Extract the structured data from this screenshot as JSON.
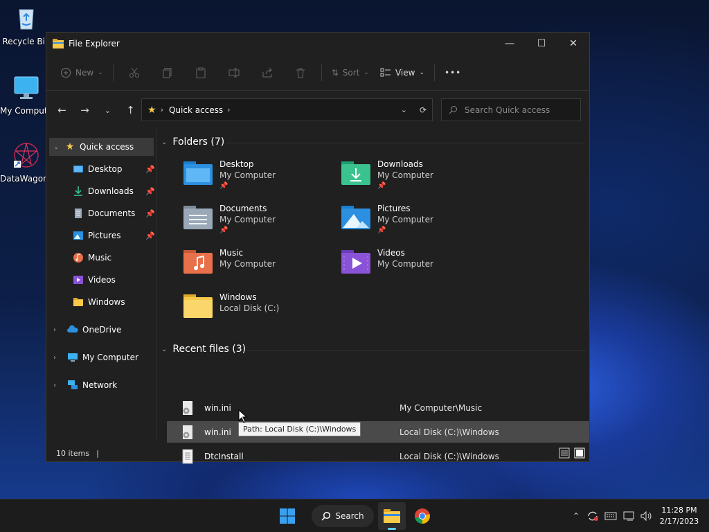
{
  "desktop": {
    "icons": [
      {
        "label": "Recycle Bin"
      },
      {
        "label": "My Computer"
      },
      {
        "label": "DataWagon..."
      }
    ]
  },
  "window": {
    "title": "File Explorer",
    "controls": {
      "minimize": "—",
      "maximize": "☐",
      "close": "✕"
    }
  },
  "toolbar": {
    "new_label": "New",
    "sort_label": "Sort",
    "view_label": "View",
    "more_label": "•••"
  },
  "address": {
    "location": "Quick access"
  },
  "search": {
    "placeholder": "Search Quick access"
  },
  "sidebar": {
    "quick_access": "Quick access",
    "pinned": [
      {
        "label": "Desktop",
        "pinned": true
      },
      {
        "label": "Downloads",
        "pinned": true
      },
      {
        "label": "Documents",
        "pinned": true
      },
      {
        "label": "Pictures",
        "pinned": true
      },
      {
        "label": "Music",
        "pinned": false
      },
      {
        "label": "Videos",
        "pinned": false
      },
      {
        "label": "Windows",
        "pinned": false
      }
    ],
    "roots": [
      {
        "label": "OneDrive"
      },
      {
        "label": "My Computer"
      },
      {
        "label": "Network"
      }
    ]
  },
  "folders": {
    "header": "Folders (7)",
    "items": [
      {
        "name": "Desktop",
        "sub": "My Computer",
        "pinned": true
      },
      {
        "name": "Downloads",
        "sub": "My Computer",
        "pinned": true
      },
      {
        "name": "Documents",
        "sub": "My Computer",
        "pinned": true
      },
      {
        "name": "Pictures",
        "sub": "My Computer",
        "pinned": true
      },
      {
        "name": "Music",
        "sub": "My Computer",
        "pinned": false
      },
      {
        "name": "Videos",
        "sub": "My Computer",
        "pinned": false
      },
      {
        "name": "Windows",
        "sub": "Local Disk (C:)",
        "pinned": false
      }
    ]
  },
  "recent": {
    "header": "Recent files (3)",
    "items": [
      {
        "name": "win.ini",
        "location": "My Computer\\Music"
      },
      {
        "name": "win.ini",
        "location": "Local Disk (C:)\\Windows"
      },
      {
        "name": "DtcInstall",
        "location": "Local Disk (C:)\\Windows"
      }
    ]
  },
  "tooltip": {
    "text": "Path: Local Disk (C:)\\Windows"
  },
  "status": {
    "items": "10 items",
    "caret": "|"
  },
  "taskbar": {
    "search_label": "Search",
    "time": "11:28 PM",
    "date": "2/17/2023"
  },
  "colors": {
    "window_bg": "#202020",
    "accent": "#0078d4",
    "folder_yellow": "#f8c94a"
  }
}
